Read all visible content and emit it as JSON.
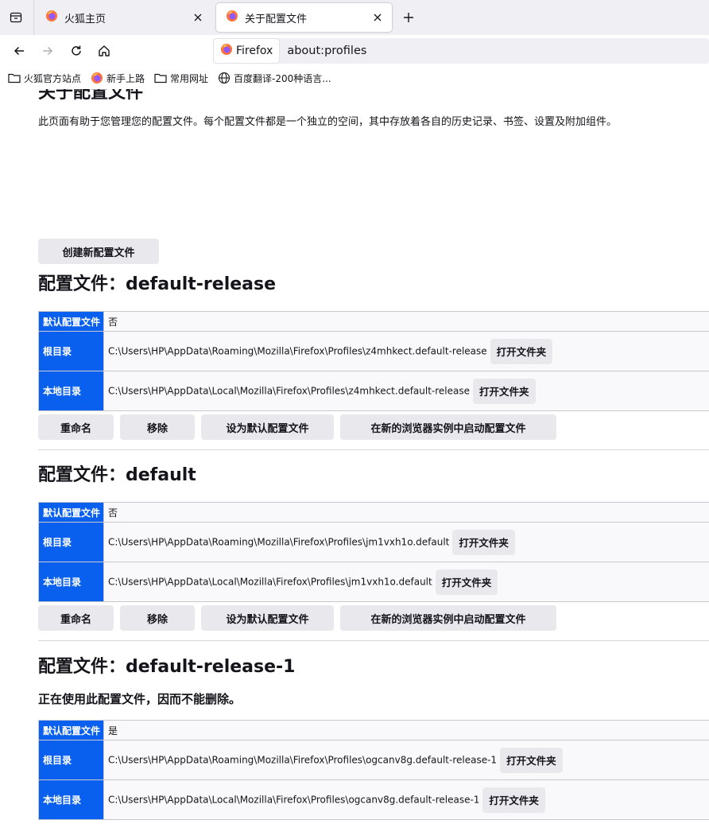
{
  "tabs": [
    {
      "title": "火狐主页",
      "active": false
    },
    {
      "title": "关于配置文件",
      "active": true
    }
  ],
  "urlbar": {
    "identity_label": "Firefox",
    "url": "about:profiles"
  },
  "bookmarks": [
    {
      "label": "火狐官方站点",
      "icon": "folder-icon"
    },
    {
      "label": "新手上路",
      "icon": "firefox-icon"
    },
    {
      "label": "常用网址",
      "icon": "folder-icon"
    },
    {
      "label": "百度翻译-200种语言...",
      "icon": "globe-icon"
    }
  ],
  "page": {
    "title": "关于配置文件",
    "intro": "此页面有助于您管理您的配置文件。每个配置文件都是一个独立的空间，其中存放着各自的历史记录、书签、设置及附加组件。",
    "create_button": "创建新配置文件"
  },
  "labels": {
    "default_profile": "默认配置文件",
    "root_dir": "根目录",
    "local_dir": "本地目录",
    "open_folder": "打开文件夹",
    "rename": "重命名",
    "remove": "移除",
    "set_default": "设为默认配置文件",
    "launch": "在新的浏览器实例中启动配置文件"
  },
  "profiles": [
    {
      "heading": "配置文件：default-release",
      "is_default": "否",
      "root": "C:\\Users\\HP\\AppData\\Roaming\\Mozilla\\Firefox\\Profiles\\z4mhkect.default-release",
      "local": "C:\\Users\\HP\\AppData\\Local\\Mozilla\\Firefox\\Profiles\\z4mhkect.default-release"
    },
    {
      "heading": "配置文件：default",
      "is_default": "否",
      "root": "C:\\Users\\HP\\AppData\\Roaming\\Mozilla\\Firefox\\Profiles\\jm1vxh1o.default",
      "local": "C:\\Users\\HP\\AppData\\Local\\Mozilla\\Firefox\\Profiles\\jm1vxh1o.default"
    },
    {
      "heading": "配置文件：default-release-1",
      "in_use_notice": "正在使用此配置文件，因而不能删除。",
      "is_default": "是",
      "root": "C:\\Users\\HP\\AppData\\Roaming\\Mozilla\\Firefox\\Profiles\\ogcanv8g.default-release-1",
      "local": "C:\\Users\\HP\\AppData\\Local\\Mozilla\\Firefox\\Profiles\\ogcanv8g.default-release-1"
    }
  ],
  "colors": {
    "accent": "#0a60ee",
    "chrome_bg": "#f0f0f4",
    "button_bg": "#e9e9ed"
  }
}
